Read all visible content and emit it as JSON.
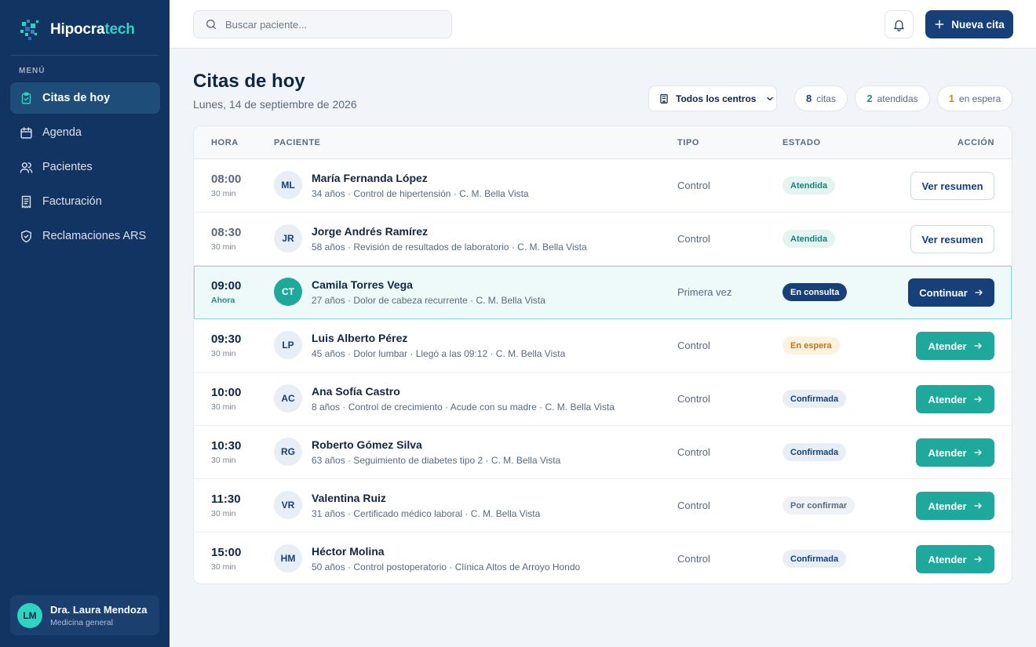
{
  "brand": {
    "name_main": "Hipocra",
    "name_accent": "tech"
  },
  "sidebar": {
    "menu_heading": "MENÚ",
    "items": [
      {
        "label": "Citas de hoy",
        "icon": "clipboard-icon",
        "active": true
      },
      {
        "label": "Agenda",
        "icon": "calendar-icon",
        "active": false
      },
      {
        "label": "Pacientes",
        "icon": "users-icon",
        "active": false
      },
      {
        "label": "Facturación",
        "icon": "receipt-icon",
        "active": false
      },
      {
        "label": "Reclamaciones ARS",
        "icon": "shield-icon",
        "active": false
      }
    ],
    "user": {
      "initials": "LM",
      "name": "Dra. Laura Mendoza",
      "role": "Medicina general"
    }
  },
  "topbar": {
    "search_placeholder": "Buscar paciente...",
    "new_button": "Nueva cita"
  },
  "header": {
    "title": "Citas de hoy",
    "date": "Lunes, 14 de septiembre de 2026",
    "center_filter": "Todos los centros",
    "stats": [
      {
        "value": "8",
        "label": "citas"
      },
      {
        "value": "2",
        "label": "atendidas"
      },
      {
        "value": "1",
        "label": "en espera"
      }
    ]
  },
  "table": {
    "columns": {
      "hora": "HORA",
      "paciente": "PACIENTE",
      "tipo": "TIPO",
      "estado": "ESTADO",
      "accion": "ACCIÓN"
    },
    "rows": [
      {
        "time": "08:00",
        "sub": "30 min",
        "initials": "ML",
        "name": "María Fernanda López",
        "desc": "34 años · Control de hipertensión · C. M. Bella Vista",
        "type": "Control",
        "status": "Atendida",
        "action": "Ver resumen"
      },
      {
        "time": "08:30",
        "sub": "30 min",
        "initials": "JR",
        "name": "Jorge Andrés Ramírez",
        "desc": "58 años · Revisión de resultados de laboratorio · C. M. Bella Vista",
        "type": "Control",
        "status": "Atendida",
        "action": "Ver resumen"
      },
      {
        "time": "09:00",
        "sub": "Ahora",
        "initials": "CT",
        "name": "Camila Torres Vega",
        "desc": "27 años · Dolor de cabeza recurrente · C. M. Bella Vista",
        "type": "Primera vez",
        "status": "En consulta",
        "action": "Continuar"
      },
      {
        "time": "09:30",
        "sub": "30 min",
        "initials": "LP",
        "name": "Luis Alberto Pérez",
        "desc": "45 años · Dolor lumbar · Llegó a las 09:12 · C. M. Bella Vista",
        "type": "Control",
        "status": "En espera",
        "action": "Atender"
      },
      {
        "time": "10:00",
        "sub": "30 min",
        "initials": "AC",
        "name": "Ana Sofía Castro",
        "desc": "8 años · Control de crecimiento · Acude con su madre · C. M. Bella Vista",
        "type": "Control",
        "status": "Confirmada",
        "action": "Atender"
      },
      {
        "time": "10:30",
        "sub": "30 min",
        "initials": "RG",
        "name": "Roberto Gómez Silva",
        "desc": "63 años · Seguimiento de diabetes tipo 2 · C. M. Bella Vista",
        "type": "Control",
        "status": "Confirmada",
        "action": "Atender"
      },
      {
        "time": "11:30",
        "sub": "30 min",
        "initials": "VR",
        "name": "Valentina Ruiz",
        "desc": "31 años · Certificado médico laboral · C. M. Bella Vista",
        "type": "Control",
        "status": "Por confirmar",
        "action": "Atender"
      },
      {
        "time": "15:00",
        "sub": "30 min",
        "initials": "HM",
        "name": "Héctor Molina",
        "desc": "50 años · Control postoperatorio · Clínica Altos de Arroyo Hondo",
        "type": "Control",
        "status": "Confirmada",
        "action": "Atender"
      }
    ]
  },
  "colors": {
    "sidebar": "#123463",
    "primary": "#173f78",
    "teal": "#1fa89c",
    "accent": "#2dd4bf"
  }
}
